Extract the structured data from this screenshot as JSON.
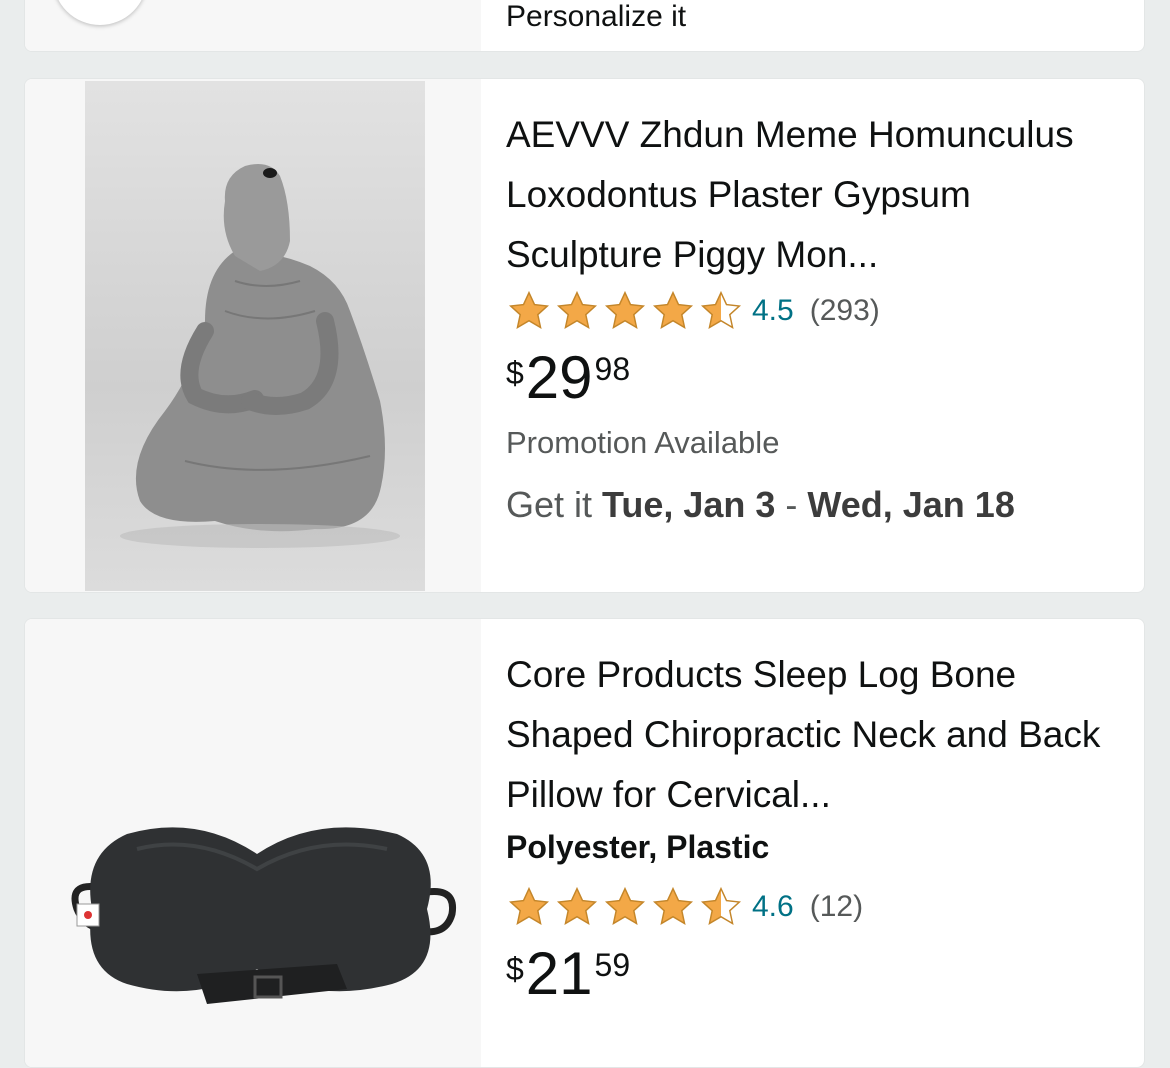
{
  "top_card": {
    "text": "Personalize it"
  },
  "products": [
    {
      "title": "AEVVV Zhdun Meme Homunculus Loxodontus Plaster Gypsum Sculpture Piggy Mon...",
      "rating": "4.5",
      "rating_count": "(293)",
      "stars": 4.5,
      "price_symbol": "$",
      "price_whole": "29",
      "price_fraction": "98",
      "promotion": "Promotion Available",
      "delivery_prefix": "Get it ",
      "delivery_start": "Tue, Jan 3",
      "delivery_sep": " - ",
      "delivery_end": "Wed, Jan 18",
      "image_icon": "zhdun-sculpture-image"
    },
    {
      "title": "Core Products Sleep Log Bone Shaped Chiropractic Neck and Back Pillow for Cervical...",
      "material": "Polyester, Plastic",
      "rating": "4.6",
      "rating_count": "(12)",
      "stars": 4.5,
      "price_symbol": "$",
      "price_whole": "21",
      "price_fraction": "59",
      "image_icon": "neck-pillow-image"
    }
  ],
  "colors": {
    "star": "#f3a847",
    "rating_link": "#007185",
    "secondary_text": "#565959",
    "primary_text": "#0f1111"
  }
}
